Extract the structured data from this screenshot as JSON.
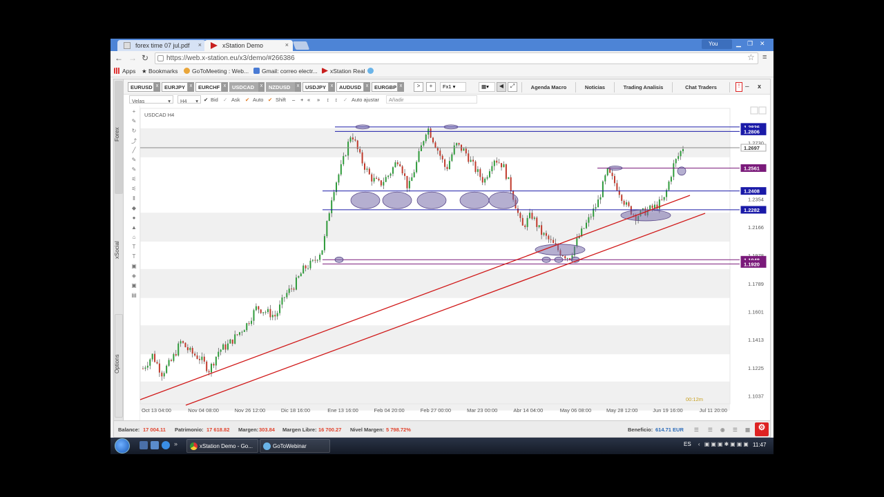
{
  "browser": {
    "tabs": [
      {
        "title": "forex time 07 jul.pdf",
        "close": "×"
      },
      {
        "title": "xStation Demo",
        "close": "×"
      }
    ],
    "user": "You",
    "url": "https://web.x-station.eu/x3/demo/#266386",
    "bookmarks": [
      "Apps",
      "Bookmarks",
      "GoToMeeting : Web...",
      "Gmail: correo electr...",
      "xStation Real"
    ]
  },
  "app": {
    "rail_tabs": [
      "Forex",
      "xSocial",
      "Options"
    ],
    "symbols": [
      {
        "label": "EURUSD",
        "selected": false
      },
      {
        "label": "EURJPY",
        "selected": false
      },
      {
        "label": "EURCHF",
        "selected": false
      },
      {
        "label": "USDCAD",
        "selected": true
      },
      {
        "label": "NZDUSD",
        "selected": true
      },
      {
        "label": "USDJPY",
        "selected": false
      },
      {
        "label": "AUDUSD",
        "selected": false
      },
      {
        "label": "EURGBP",
        "selected": false
      }
    ],
    "symbol_close": "x",
    "nav_next": ">",
    "add_symbol": "+",
    "layout_value": "Fx1",
    "top_tabs": [
      "Agenda Macro",
      "Noticias",
      "Trading Analisis",
      "Chat Traders"
    ],
    "window_min": "–",
    "window_close": "x"
  },
  "chart_toolbar": {
    "type_value": "Velas",
    "timeframe_value": "H4",
    "bid": "Bid",
    "ask": "Ask",
    "auto": "Auto",
    "shift": "Shift",
    "auto_fit": "Auto ajustar",
    "add_placeholder": "Añadir"
  },
  "chart_data": {
    "type": "candlestick",
    "title": "USDCAD H4",
    "x_labels": [
      "Oct 13 04:00",
      "Nov 04 08:00",
      "Nov 26 12:00",
      "Dic 18 16:00",
      "Ene 13 16:00",
      "Feb 04 20:00",
      "Feb 27 00:00",
      "Mar 23 00:00",
      "Abr 14 04:00",
      "May 06 08:00",
      "May 28 12:00",
      "Jun 19 16:00",
      "Jul 11 20:00"
    ],
    "y_ticks": [
      "1.2730",
      "1.2354",
      "1.2166",
      "1.1978",
      "1.1789",
      "1.1601",
      "1.1413",
      "1.1225",
      "1.1037"
    ],
    "ylim": [
      1.0985,
      1.296
    ],
    "price_tags": [
      {
        "price": 1.2836,
        "label": "1.2836",
        "color": "#1a1aa8"
      },
      {
        "price": 1.2806,
        "label": "1.2806",
        "color": "#1a1aa8"
      },
      {
        "price": 1.2697,
        "label": "1.2697",
        "color": "#ffffff"
      },
      {
        "price": 1.2561,
        "label": "1.2561",
        "color": "#7a1a7a"
      },
      {
        "price": 1.2408,
        "label": "1.2408",
        "color": "#1a1aa8"
      },
      {
        "price": 1.2282,
        "label": "1.2282",
        "color": "#1a1aa8"
      },
      {
        "price": 1.1948,
        "label": "1.1948",
        "color": "#7a1a7a"
      },
      {
        "price": 1.192,
        "label": "1.1920",
        "color": "#7a1a7a"
      }
    ],
    "close_series": [
      1.122,
      1.131,
      1.119,
      1.127,
      1.14,
      1.133,
      1.129,
      1.121,
      1.134,
      1.138,
      1.145,
      1.152,
      1.163,
      1.16,
      1.157,
      1.171,
      1.178,
      1.189,
      1.193,
      1.203,
      1.24,
      1.258,
      1.28,
      1.262,
      1.25,
      1.245,
      1.252,
      1.263,
      1.242,
      1.262,
      1.284,
      1.27,
      1.255,
      1.272,
      1.267,
      1.256,
      1.247,
      1.263,
      1.258,
      1.239,
      1.216,
      1.225,
      1.213,
      1.207,
      1.2,
      1.196,
      1.21,
      1.221,
      1.233,
      1.254,
      1.244,
      1.231,
      1.224,
      1.227,
      1.23,
      1.235,
      1.258,
      1.27
    ],
    "countdown": "00:12m"
  },
  "status": {
    "balance_label": "Balance:",
    "balance": "17 004.11",
    "equity_label": "Patrimonio:",
    "equity": "17 618.82",
    "margin_label": "Margen:",
    "margin": "303.84",
    "free_label": "Margen Libre:",
    "free": "16 700.27",
    "level_label": "Nivel Margen:",
    "level": "5 798.72%",
    "profit_label": "Beneficio:",
    "profit": "614.71 EUR"
  },
  "taskbar": {
    "tasks": [
      "xStation Demo - Go...",
      "GoToWebinar"
    ],
    "lang": "ES",
    "time": "11:47"
  }
}
